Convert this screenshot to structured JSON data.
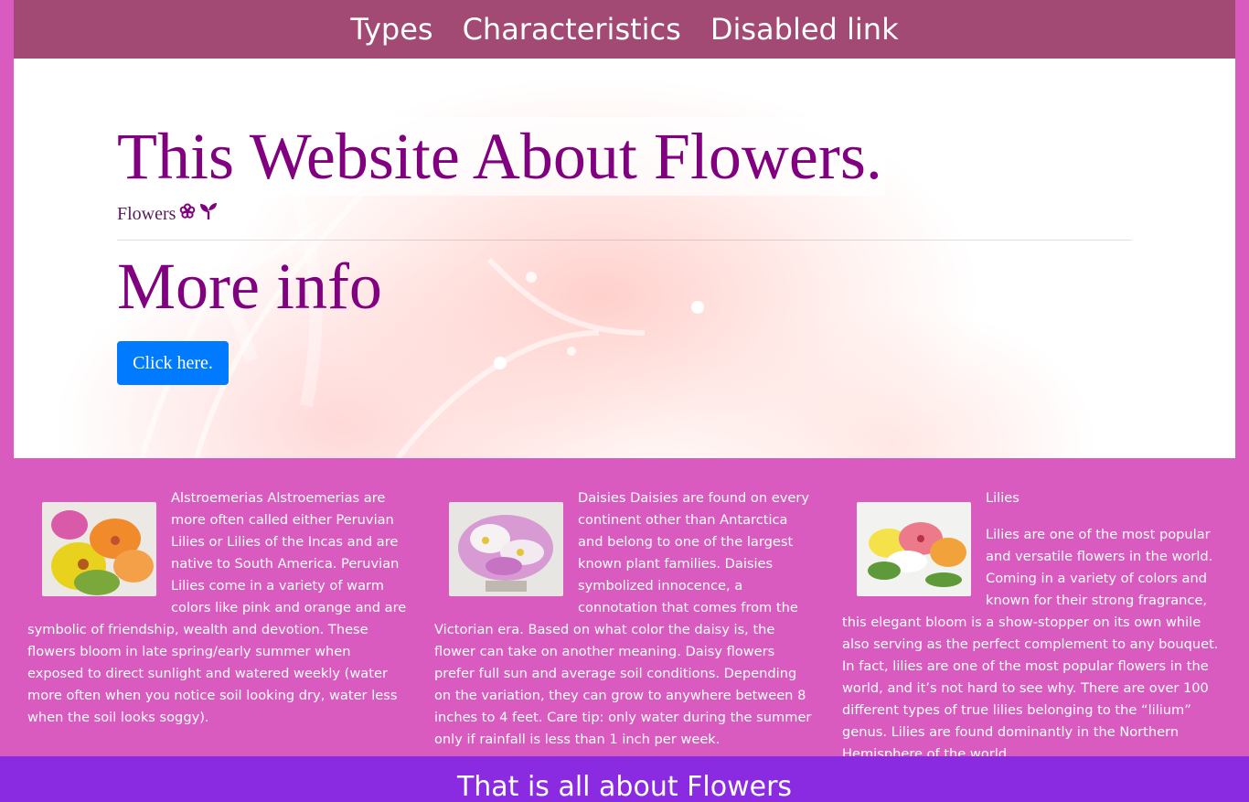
{
  "nav": {
    "links": [
      {
        "label": "Types"
      },
      {
        "label": "Characteristics"
      },
      {
        "label": "Disabled link"
      }
    ]
  },
  "hero": {
    "title": "This Website About Flowers.",
    "subtitle": "Flowers",
    "subtitle_icons": [
      "flower-icon",
      "sprout-icon"
    ],
    "more_info": "More info",
    "button_label": "Click here."
  },
  "cards": [
    {
      "image": "alstroemeria-bouquet",
      "text": "Alstroemerias Alstroemerias are more often called either Peruvian Lilies or Lilies of the Incas and are native to South America. Peruvian Lilies come in a variety of warm colors like pink and orange and are symbolic of friendship, wealth and devotion. These flowers bloom in late spring/early summer when exposed to direct sunlight and watered weekly (water more often when you notice soil looking dry, water less when the soil looks soggy)."
    },
    {
      "image": "daisy-bouquet",
      "text": "Daisies Daisies are found on every continent other than Antarctica and belong to one of the largest known plant families. Daisies symbolized innocence, a connotation that comes from the Victorian era. Based on what color the daisy is, the flower can take on another meaning. Daisy flowers prefer full sun and average soil conditions. Depending on the variation, they can grow to anywhere between 8 inches to 4 feet. Care tip: only water during the summer only if rainfall is less than 1 inch per week."
    },
    {
      "image": "lily-bouquet",
      "heading": "Lilies",
      "text": "Lilies are one of the most popular and versatile flowers in the world. Coming in a variety of colors and known for their strong fragrance, this elegant bloom is a show-stopper on its own while also serving as the perfect complement to any bouquet. In fact, lilies are one of the most popular flowers in the world, and it’s not hard to see why. There are over 100 different types of true lilies belonging to the “lilium” genus. Lilies are found dominantly in the Northern Hemisphere of the world."
    }
  ],
  "footer": {
    "text": "That is all about Flowers"
  }
}
